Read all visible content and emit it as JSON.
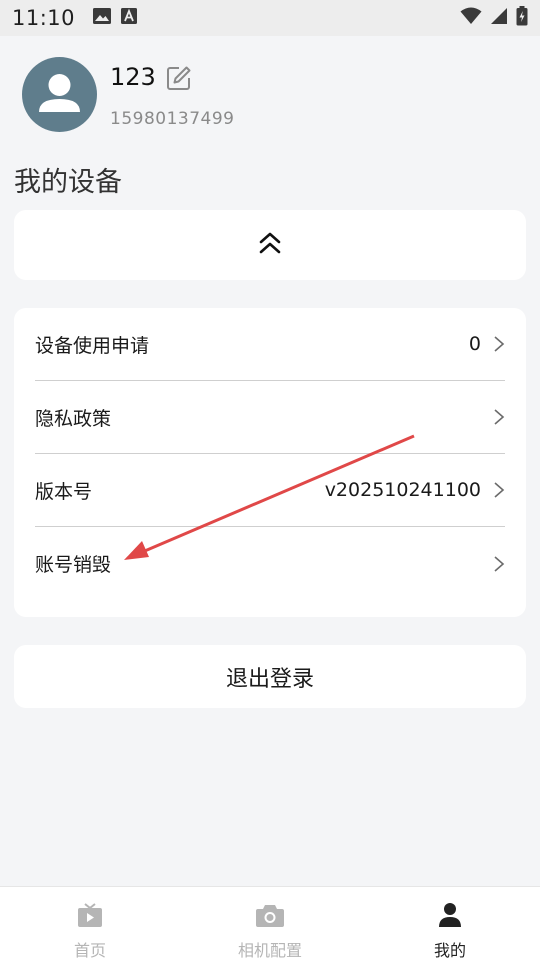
{
  "status_bar": {
    "time": "11:10",
    "left_icons": [
      "image-icon",
      "text-a-icon"
    ],
    "right_icons": [
      "wifi-icon",
      "signal-icon",
      "battery-charging-icon"
    ]
  },
  "profile": {
    "username": "123",
    "phone": "15980137499",
    "avatar_color": "#5f7d8c"
  },
  "section_title": "我的设备",
  "device_card": {
    "icon": "double-chevron-up-icon"
  },
  "menu": [
    {
      "label": "设备使用申请",
      "value": "0"
    },
    {
      "label": "隐私政策",
      "value": ""
    },
    {
      "label": "版本号",
      "value": "v202510241100"
    },
    {
      "label": "账号销毁",
      "value": ""
    }
  ],
  "logout_label": "退出登录",
  "bottom_nav": [
    {
      "label": "首页",
      "icon": "tv-icon",
      "active": false
    },
    {
      "label": "相机配置",
      "icon": "camera-icon",
      "active": false
    },
    {
      "label": "我的",
      "icon": "person-icon",
      "active": true
    }
  ],
  "colors": {
    "background": "#f4f5f7",
    "card": "#ffffff",
    "annotation_arrow": "#e04848",
    "inactive_nav": "#b5b5b5"
  }
}
